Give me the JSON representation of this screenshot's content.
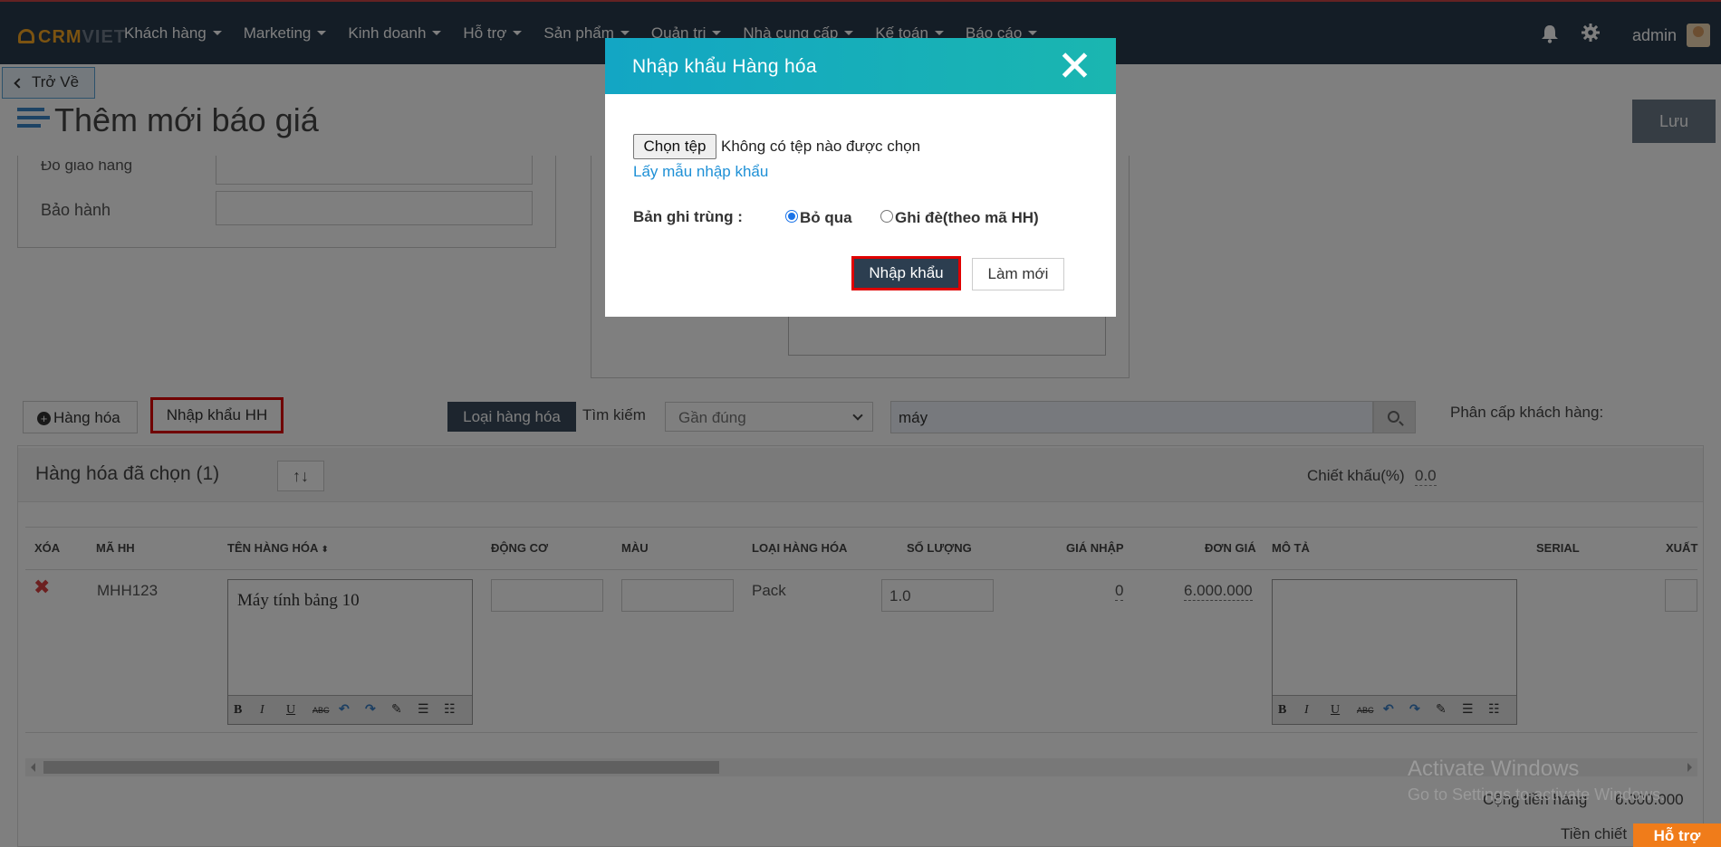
{
  "nav": {
    "logo_main": "CRM",
    "logo_sub": "VIET",
    "items": [
      {
        "label": "Khách hàng"
      },
      {
        "label": "Marketing"
      },
      {
        "label": "Kinh doanh"
      },
      {
        "label": "Hỗ trợ"
      },
      {
        "label": "Sản phẩm"
      },
      {
        "label": "Quản trị"
      },
      {
        "label": "Nhà cung cấp"
      },
      {
        "label": "Kế toán"
      },
      {
        "label": "Báo cáo"
      }
    ],
    "bell_icon": "bell-icon",
    "gear_icon": "gear-icon",
    "user": "admin",
    "bg_color": "#283a4d"
  },
  "header": {
    "back_label": "Trở Về",
    "title": "Thêm mới báo giá",
    "save_label": "Lưu"
  },
  "form": {
    "cut_label": "Đổ giao hàng",
    "warranty_label": "Bảo hành"
  },
  "toolbar": {
    "add_goods_label": "Hàng hóa",
    "import_goods_label": "Nhập khẩu HH",
    "type_button_label": "Loại hàng hóa",
    "search_label": "Tìm kiếm",
    "match_select_value": "Gần đúng",
    "search_value": "máy",
    "customer_tier_label": "Phân cấp khách hàng:"
  },
  "selected": {
    "title": "Hàng hóa đã chọn (1)",
    "sort_icon": "↑↓",
    "discount_label": "Chiết khấu(%)",
    "discount_value": "0.0",
    "columns": [
      "XÓA",
      "MÃ HH",
      "TÊN HÀNG HÓA",
      "ĐỘNG CƠ",
      "MÀU",
      "LOẠI HÀNG HÓA",
      "SỐ LƯỢNG",
      "GIÁ NHẬP",
      "ĐƠN GIÁ",
      "MÔ TẢ",
      "SERIAL",
      "XUẤT"
    ],
    "sort_marker": "⬍",
    "row": {
      "code": "MHH123",
      "name": "Máy tính bảng 10",
      "type": "Pack",
      "quantity": "1.0",
      "import_price": "0",
      "unit_price": "6.000.000"
    },
    "total_label": "Cộng tiền hàng",
    "total_value": "6.000.000",
    "discount_total_label": "Tiền chiết"
  },
  "editor_toolbar": [
    "B",
    "I",
    "U",
    "ABC",
    "↶",
    "↷",
    "✎",
    "☰",
    "☷"
  ],
  "watermark": {
    "line1": "Activate Windows",
    "line2": "Go to Settings to activate Windows."
  },
  "help_label": "Hỗ trợ",
  "modal": {
    "title": "Nhập khẩu Hàng hóa",
    "file_button": "Chọn tệp",
    "file_status": "Không có tệp nào được chọn",
    "sample_link": "Lấy mẫu nhập khẩu",
    "duplicate_label": "Bản ghi trùng :",
    "option_skip": "Bỏ qua",
    "option_overwrite": "Ghi đè(theo mã HH)",
    "import_button": "Nhập khẩu",
    "reset_button": "Làm mới",
    "accent_color": "#13a6c4"
  }
}
